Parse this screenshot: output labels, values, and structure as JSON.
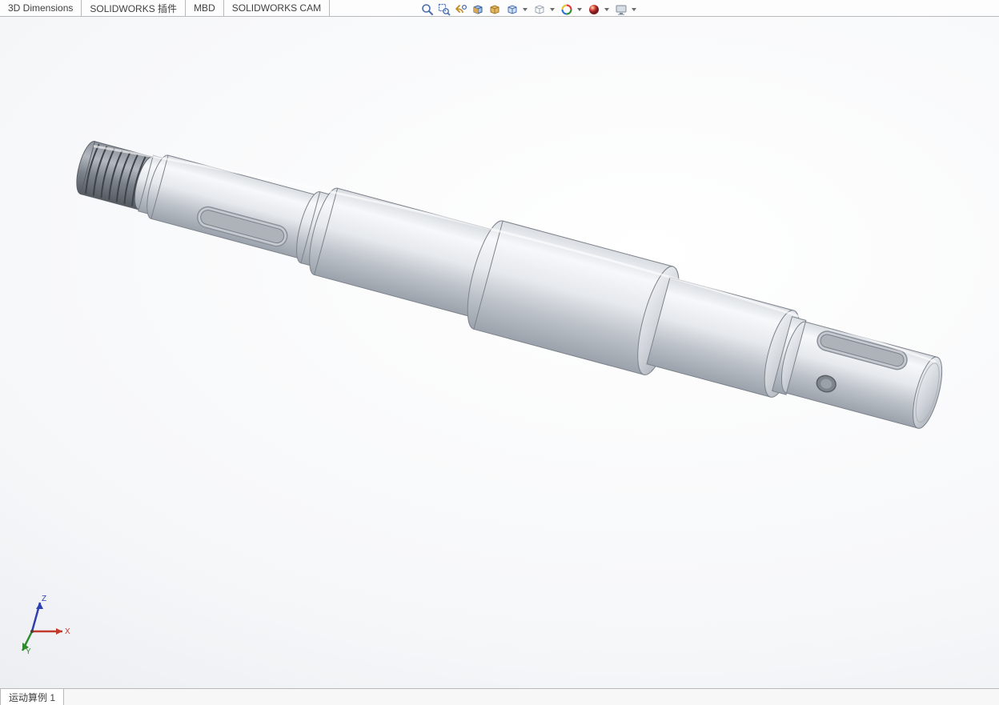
{
  "tabs": {
    "items": [
      {
        "label": "3D Dimensions",
        "cut": true
      },
      {
        "label": "SOLIDWORKS 插件"
      },
      {
        "label": "MBD"
      },
      {
        "label": "SOLIDWORKS CAM"
      }
    ]
  },
  "view_toolbar": {
    "zoom_fit": "zoom-to-fit",
    "zoom_area": "zoom-to-area",
    "prev_view": "previous-view",
    "section": "section-view",
    "orientation": "view-orientation",
    "display_style": "display-style",
    "hide_show": "hide-show-items",
    "edit_appearance": "edit-appearance",
    "apply_scene": "apply-scene",
    "view_settings": "view-settings"
  },
  "viewport": {
    "triad": {
      "x": "X",
      "y": "Y",
      "z": "Z"
    },
    "model_description": "Stepped shaft with threaded left end, two keyway slots, multiple diameter steps"
  },
  "bottom_tabs": {
    "items": [
      {
        "label": "运动算例 1"
      }
    ]
  }
}
